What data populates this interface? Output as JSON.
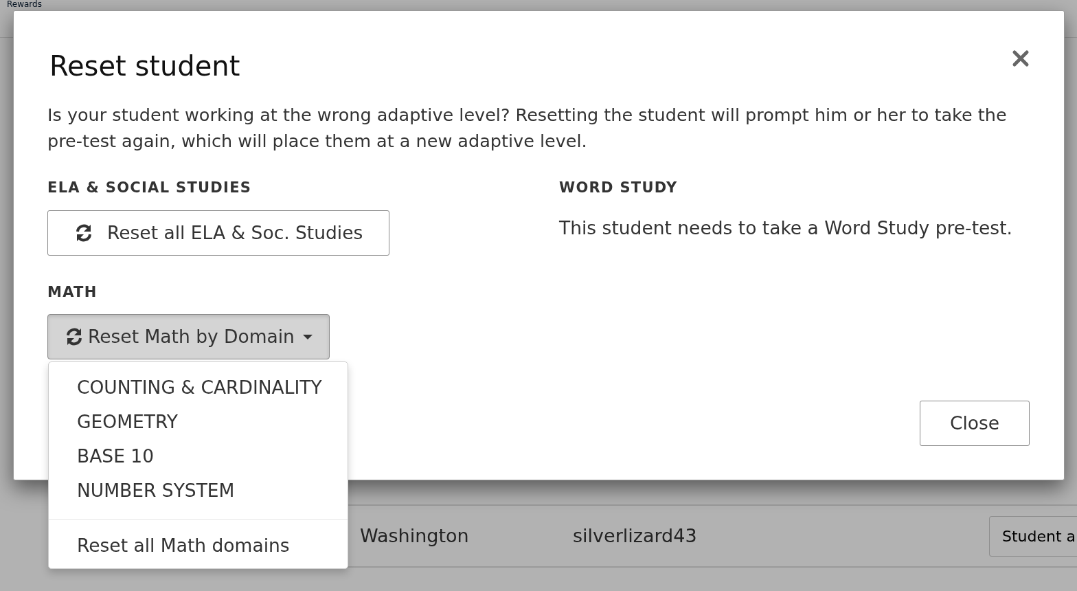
{
  "background": {
    "nav_link": "Rewards",
    "rows": [
      {
        "first_name": "",
        "last_name": "Washington",
        "username": "silverlizard43",
        "action": "Student a"
      }
    ]
  },
  "modal": {
    "title": "Reset student",
    "description": "Is your student working at the wrong adaptive level? Resetting the student will prompt him or her to take the pre-test again, which will place them at a new adaptive level.",
    "sections": [
      {
        "kind": "button",
        "heading": "ELA & SOCIAL STUDIES",
        "button": "Reset all ELA & Soc. Studies"
      },
      {
        "kind": "dropdown",
        "heading": "MATH",
        "button": "Reset Math by Domain",
        "expanded": true,
        "items": [
          "COUNTING & CARDINALITY",
          "GEOMETRY",
          "BASE 10",
          "NUMBER SYSTEM"
        ],
        "footer_item": "Reset all Math domains"
      },
      {
        "kind": "text",
        "heading": "WORD STUDY",
        "text": "This student needs to take a Word Study pre-test."
      }
    ],
    "footer_button": "Close"
  }
}
